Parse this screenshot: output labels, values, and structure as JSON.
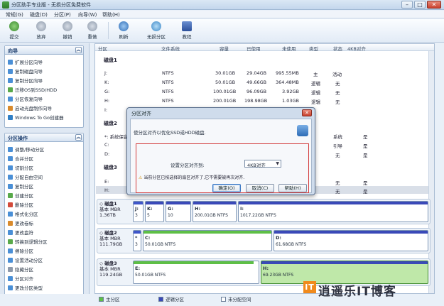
{
  "window": {
    "title": "分区助手专业版 - 无损分区免费软件",
    "min": "–",
    "max": "□",
    "close": "✕"
  },
  "menu": [
    "常规(G)",
    "磁盘(D)",
    "分区(P)",
    "向导(W)",
    "帮助(H)"
  ],
  "toolbar": [
    {
      "label": "提交",
      "icon": "check-icon"
    },
    {
      "label": "放弃",
      "icon": "discard-icon"
    },
    {
      "label": "撤销",
      "icon": "undo-icon"
    },
    {
      "label": "重做",
      "icon": "redo-icon"
    },
    {
      "label": "刷新",
      "icon": "refresh-icon"
    },
    {
      "label": "无损分区",
      "icon": "split-icon"
    },
    {
      "label": "教程",
      "icon": "tutorial-icon"
    }
  ],
  "sidebar": {
    "wizard_title": "向导",
    "wizard_items": [
      "扩展分区向导",
      "复制磁盘向导",
      "复制分区向导",
      "迁移OS到SSD/HDD",
      "分区恢复向导",
      "启动光盘制作向导",
      "Windows To Go创建器"
    ],
    "ops_title": "分区操作",
    "ops_items": [
      "调整/移动分区",
      "合并分区",
      "切割分区",
      "分配自由空间",
      "复制分区",
      "创建分区",
      "删除分区",
      "格式化分区",
      "更改卷标",
      "更改盘符",
      "转换到逻辑分区",
      "擦除分区",
      "设置活动分区",
      "隐藏分区",
      "分区对齐",
      "更改分区类型"
    ],
    "collapse": "︽"
  },
  "table": {
    "headers": [
      "分区",
      "文件系统",
      "容量",
      "已使用",
      "未使用",
      "类型",
      "状态",
      "4KB对齐"
    ],
    "disk1_label": "磁盘1",
    "disk1_rows": [
      [
        "J:",
        "NTFS",
        "30.01GB",
        "29.04GB",
        "995.55MB",
        "主",
        "活动",
        ""
      ],
      [
        "K:",
        "NTFS",
        "50.01GB",
        "49.66GB",
        "364.48MB",
        "逻辑",
        "无",
        ""
      ],
      [
        "G:",
        "NTFS",
        "100.01GB",
        "96.09GB",
        "3.92GB",
        "逻辑",
        "无",
        ""
      ],
      [
        "H:",
        "NTFS",
        "200.01GB",
        "198.98GB",
        "1.03GB",
        "逻辑",
        "无",
        ""
      ],
      [
        "I:",
        "",
        "",
        "",
        "",
        "",
        "",
        ""
      ]
    ],
    "disk2_label": "磁盘2",
    "disk2_rows": [
      [
        "*: 系统保留",
        "",
        "",
        "",
        "",
        "",
        "系统",
        "是"
      ],
      [
        "C:",
        "",
        "",
        "",
        "",
        "",
        "引导",
        "是"
      ],
      [
        "D:",
        "",
        "",
        "",
        "",
        "",
        "无",
        "是"
      ]
    ],
    "disk3_label": "磁盘3",
    "disk3_rows": [
      [
        "E:",
        "",
        "",
        "",
        "",
        "",
        "无",
        "是"
      ],
      [
        "H:",
        "",
        "",
        "",
        "",
        "",
        "无",
        "是"
      ]
    ]
  },
  "diskmap": [
    {
      "name": "磁盘1",
      "type": "基本 MBR",
      "size": "1.36TB",
      "parts": [
        {
          "letter": "J:",
          "size": "3"
        },
        {
          "letter": "K:",
          "size": "5"
        },
        {
          "letter": "G:",
          "size": "10"
        },
        {
          "letter": "H:",
          "size": "200.01GB NTFS"
        },
        {
          "letter": "I:",
          "size": "1017.22GB NTFS"
        }
      ]
    },
    {
      "name": "磁盘2",
      "type": "基本 MBR",
      "size": "111.79GB",
      "parts": [
        {
          "letter": "*",
          "size": "3"
        },
        {
          "letter": "C:",
          "size": "50.01GB NTFS"
        },
        {
          "letter": "D:",
          "size": "61.68GB NTFS"
        }
      ]
    },
    {
      "name": "磁盘3",
      "type": "基本 MBR",
      "size": "119.24GB",
      "parts": [
        {
          "letter": "E:",
          "size": "50.01GB NTFS"
        },
        {
          "letter": "H:",
          "size": "69.23GB NTFS"
        }
      ]
    }
  ],
  "legend": [
    "主分区",
    "逻辑分区",
    "未分配空间"
  ],
  "dialog": {
    "title": "分区对齐",
    "description": "使分区对齐以优化SSD或HDD磁盘.",
    "setting_label": "设置分区对齐到:",
    "setting_value": "4KB对齐",
    "warning": "当前分区已按选择的扇区对齐了,它不需要被再次对齐.",
    "ok": "确定(O)",
    "cancel": "取消(C)",
    "help": "帮助(H)",
    "close": "✕"
  },
  "watermark": {
    "logo": "IT",
    "text": "逍遥乐IT博客"
  },
  "colors": {
    "primary": "#3f56c9",
    "logical": "#3a49b8",
    "used": "#5ebf46",
    "unallocated": "#ffffff",
    "selection": "#bfe8a9"
  }
}
